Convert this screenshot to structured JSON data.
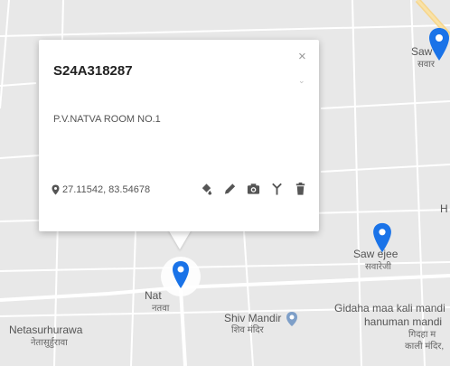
{
  "popup": {
    "title": "S24A318287",
    "description": "P.V.NATVA ROOM NO.1",
    "coordinates": "27.11542, 83.54678",
    "close_glyph": "×",
    "tools": [
      "paint-bucket-icon",
      "pencil-icon",
      "camera-icon",
      "antenna-icon",
      "trash-icon"
    ]
  },
  "map": {
    "labels": {
      "saw_top_en": "Saw",
      "saw_top_hi": "सवार",
      "sawrejee_en": "Saw ejee",
      "sawrejee_hi": "सवारेजी",
      "natva_en": "Nat",
      "natva_hi": "नतवा",
      "shiv_mandir_en": "Shiv Mandir",
      "shiv_mandir_hi": "शिव मंदिर",
      "gidaha_line1": "Gidaha maa kali mandi",
      "gidaha_line2": "hanuman mandi",
      "gidaha_line3": "गिदहा म",
      "gidaha_line4": "काली मंदिर,",
      "netasur_en": "Netasurhurawa",
      "netasur_hi": "नेतासुर्हुरावा",
      "edge_h": "H"
    },
    "colors": {
      "land": "#e8e8e8",
      "road": "#ffffff",
      "marker": "#1a73e8",
      "poi": "#7e9fc8"
    }
  }
}
